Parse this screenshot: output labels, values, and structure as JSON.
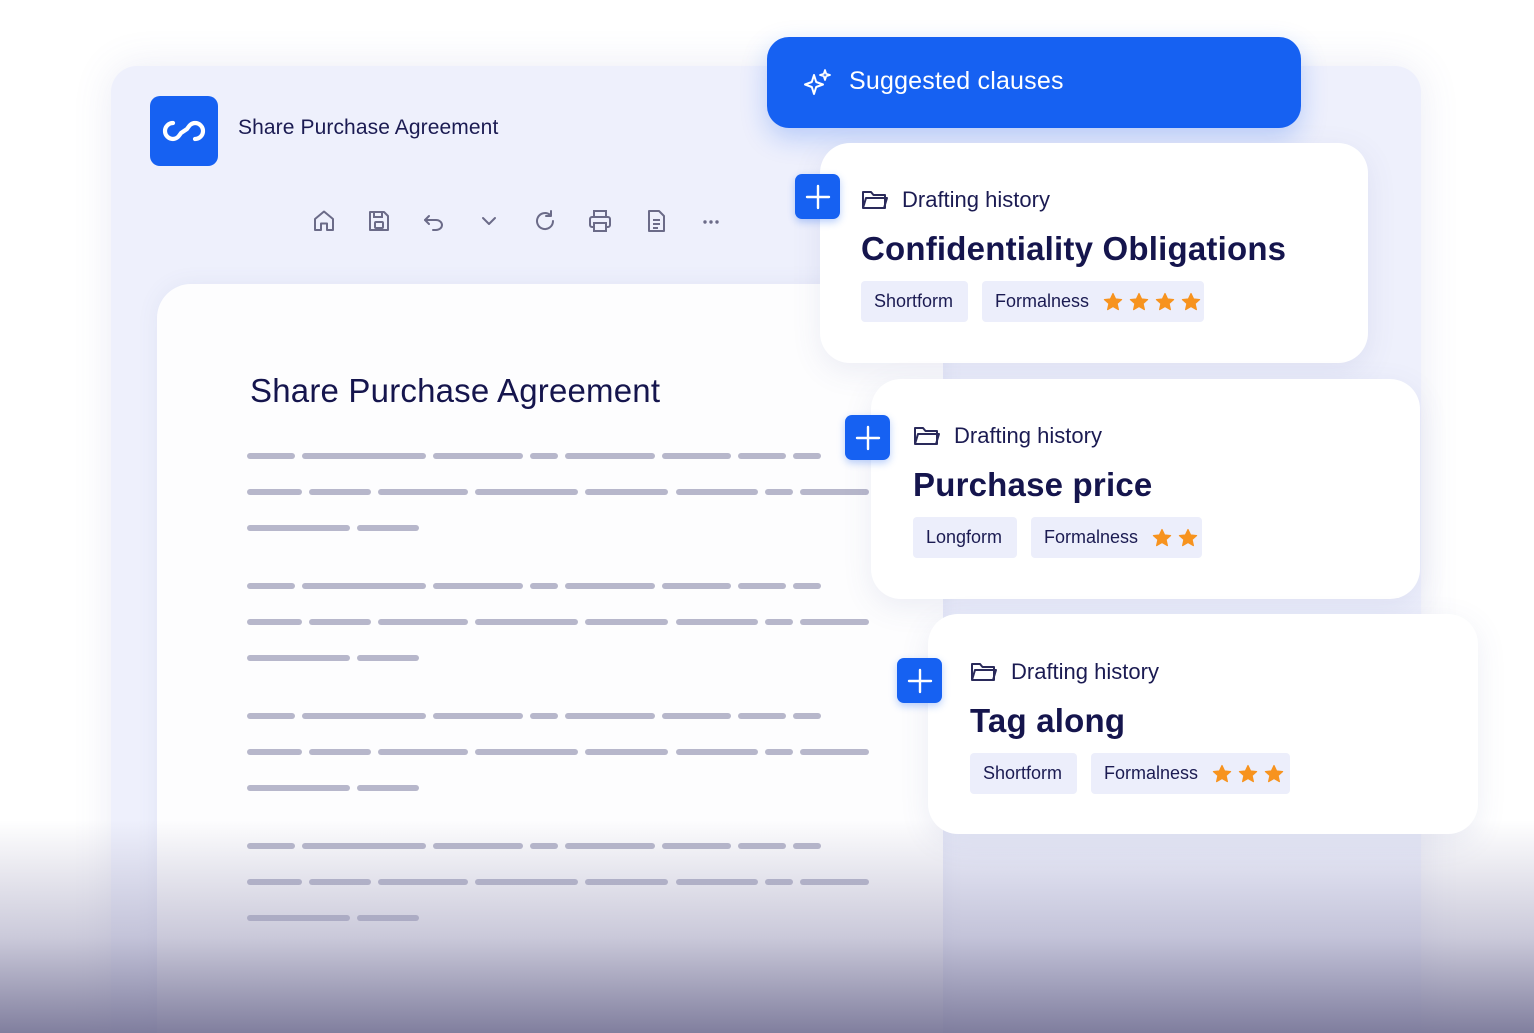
{
  "app": {
    "title": "Share Purchase Agreement"
  },
  "toolbar": {
    "buttons": [
      {
        "icon": "home-icon"
      },
      {
        "icon": "save-icon"
      },
      {
        "icon": "undo-icon"
      },
      {
        "icon": "chevron-down-icon"
      },
      {
        "icon": "refresh-icon"
      },
      {
        "icon": "print-icon"
      },
      {
        "icon": "document-icon"
      },
      {
        "icon": "more-icon"
      }
    ]
  },
  "document": {
    "title": "Share Purchase Agreement"
  },
  "suggestions": {
    "header": "Suggested clauses",
    "cards": [
      {
        "source": "Drafting history",
        "title": "Confidentiality Obligations",
        "length_tag": "Shortform",
        "formalness_label": "Formalness",
        "formalness_stars": 4
      },
      {
        "source": "Drafting history",
        "title": "Purchase price",
        "length_tag": "Longform",
        "formalness_label": "Formalness",
        "formalness_stars": 2
      },
      {
        "source": "Drafting history",
        "title": "Tag along",
        "length_tag": "Shortform",
        "formalness_label": "Formalness",
        "formalness_stars": 3
      }
    ]
  },
  "colors": {
    "accent": "#1661f2",
    "star": "#f7931e",
    "text": "#15154d",
    "placeholder_line": "#b7b7cb"
  }
}
